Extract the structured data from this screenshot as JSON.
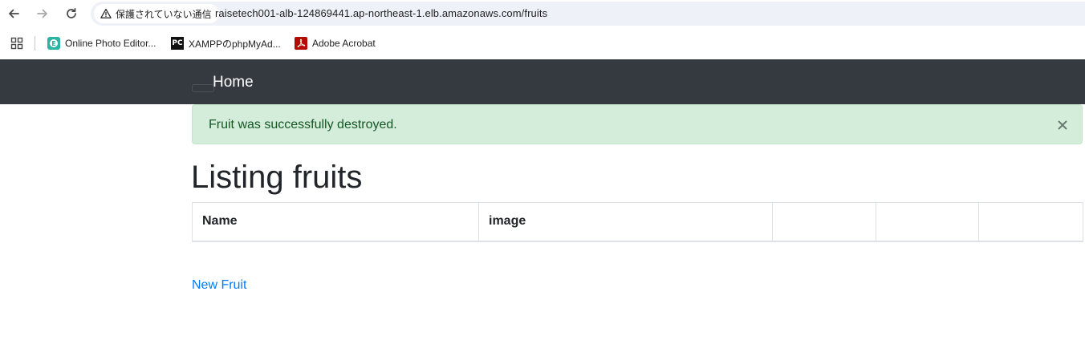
{
  "browser": {
    "security_label": "保護されていない通信",
    "url": "raisetech001-alb-124869441.ap-northeast-1.elb.amazonaws.com/fruits",
    "bookmarks": [
      {
        "label": "Online Photo Editor..."
      },
      {
        "label": "XAMPPのphpMyAd..."
      },
      {
        "label": "Adobe Acrobat"
      }
    ],
    "bookmark_icon_text": "PC"
  },
  "navbar": {
    "brand": "Home"
  },
  "alert": {
    "message": "Fruit was successfully destroyed."
  },
  "main": {
    "title": "Listing fruits",
    "table": {
      "columns": [
        "Name",
        "image",
        "",
        "",
        ""
      ]
    },
    "new_link": "New Fruit"
  },
  "colors": {
    "navbar_bg": "#343a40",
    "alert_bg": "#d4edda",
    "alert_text": "#155724",
    "link": "#007bff"
  },
  "icons": {
    "back": "arrow-left-icon",
    "forward": "arrow-right-icon",
    "reload": "reload-icon",
    "warning": "warning-triangle-icon",
    "apps": "apps-grid-icon",
    "close": "close-icon"
  }
}
